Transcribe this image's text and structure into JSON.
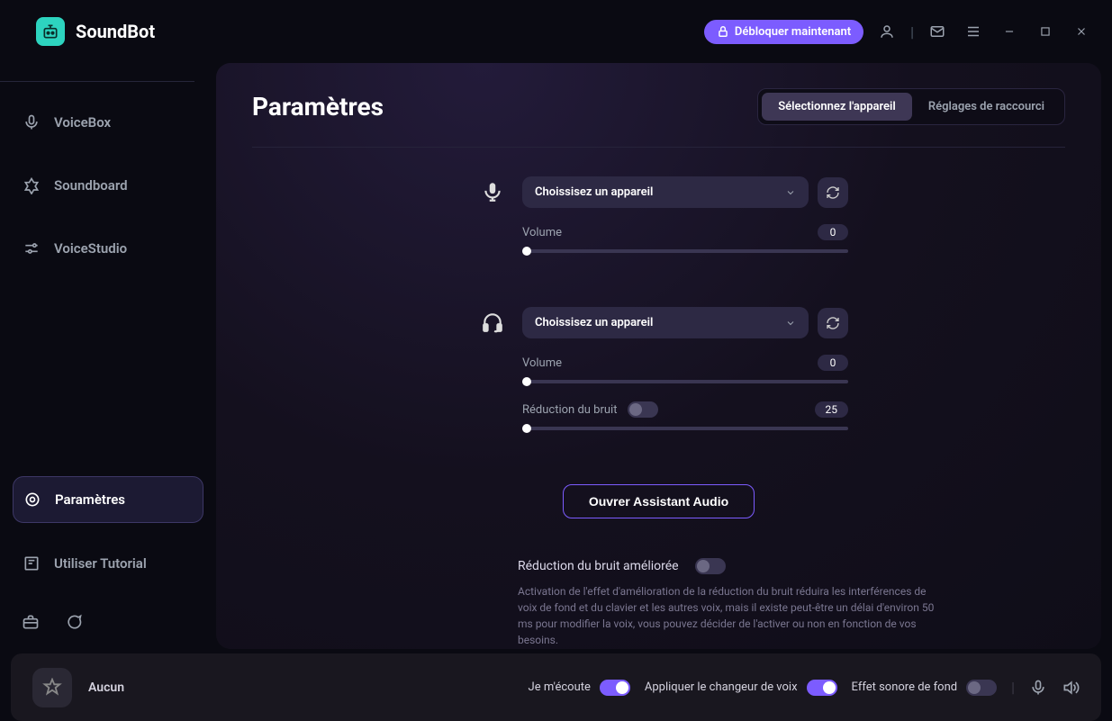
{
  "app": {
    "name": "SoundBot"
  },
  "header": {
    "unlock_label": "Débloquer maintenant"
  },
  "sidebar": {
    "items": [
      {
        "label": "VoiceBox"
      },
      {
        "label": "Soundboard"
      },
      {
        "label": "VoiceStudio"
      }
    ],
    "bottom_items": [
      {
        "label": "Paramètres",
        "active": true
      },
      {
        "label": "Utiliser Tutorial"
      }
    ]
  },
  "main": {
    "title": "Paramètres",
    "tabs": {
      "device": "Sélectionnez l'appareil",
      "shortcuts": "Réglages de raccourci"
    },
    "input_device": {
      "placeholder": "Choissisez un appareil",
      "volume_label": "Volume",
      "volume_value": "0"
    },
    "output_device": {
      "placeholder": "Choissisez un appareil",
      "volume_label": "Volume",
      "volume_value": "0",
      "noise_label": "Réduction du bruit",
      "noise_value": "25"
    },
    "assistant_button": "Ouvrer Assistant Audio",
    "enhanced": {
      "title": "Réduction du bruit améliorée",
      "desc": "Activation de l'effet d'amélioration de la réduction du bruit réduira les interférences de voix de fond et du clavier et les autres voix, mais il existe peut-être un délai d'environ 50 ms pour modifier la voix, vous pouvez décider de l'activer ou non en fonction de vos besoins."
    }
  },
  "footer": {
    "status": "Aucun",
    "listen_label": "Je m'écoute",
    "apply_label": "Appliquer le changeur de voix",
    "bg_label": "Effet sonore de fond"
  }
}
